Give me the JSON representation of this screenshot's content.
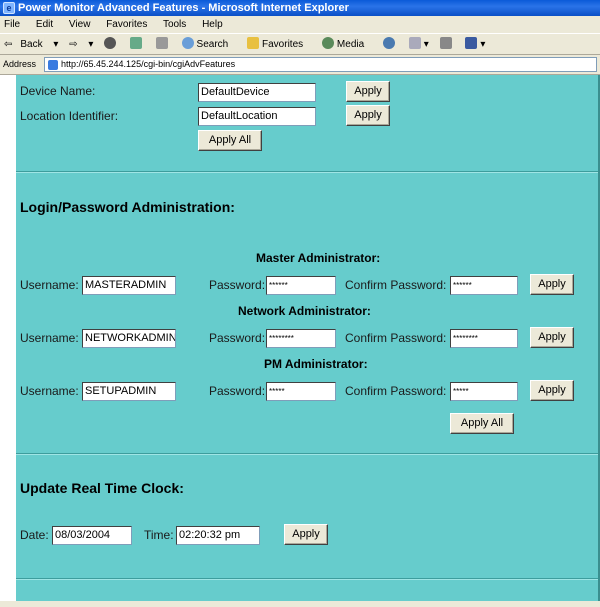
{
  "window": {
    "title": "Power Monitor Advanced Features - Microsoft Internet Explorer"
  },
  "menu": [
    "File",
    "Edit",
    "View",
    "Favorites",
    "Tools",
    "Help"
  ],
  "toolbar": {
    "back": "Back",
    "search": "Search",
    "favorites": "Favorites",
    "media": "Media"
  },
  "address": {
    "label": "Address",
    "url": "http://65.45.244.125/cgi-bin/cgiAdvFeatures"
  },
  "device": {
    "name_label": "Device Name:",
    "name_value": "DefaultDevice",
    "location_label": "Location Identifier:",
    "location_value": "DefaultLocation",
    "apply": "Apply",
    "apply_all": "Apply All"
  },
  "login": {
    "title": "Login/Password Administration:",
    "username_label": "Username:",
    "password_label": "Password:",
    "confirm_label": "Confirm Password:",
    "apply": "Apply",
    "apply_all": "Apply All",
    "admins": [
      {
        "title": "Master Administrator:",
        "username": "MASTERADMIN",
        "password": "******",
        "confirm": "******"
      },
      {
        "title": "Network Administrator:",
        "username": "NETWORKADMIN",
        "password": "********",
        "confirm": "********"
      },
      {
        "title": "PM Administrator:",
        "username": "SETUPADMIN",
        "password": "*****",
        "confirm": "*****"
      }
    ]
  },
  "clock": {
    "title": "Update Real Time Clock:",
    "date_label": "Date:",
    "date_value": "08/03/2004",
    "time_label": "Time:",
    "time_value": "02:20:32 pm",
    "apply": "Apply"
  }
}
